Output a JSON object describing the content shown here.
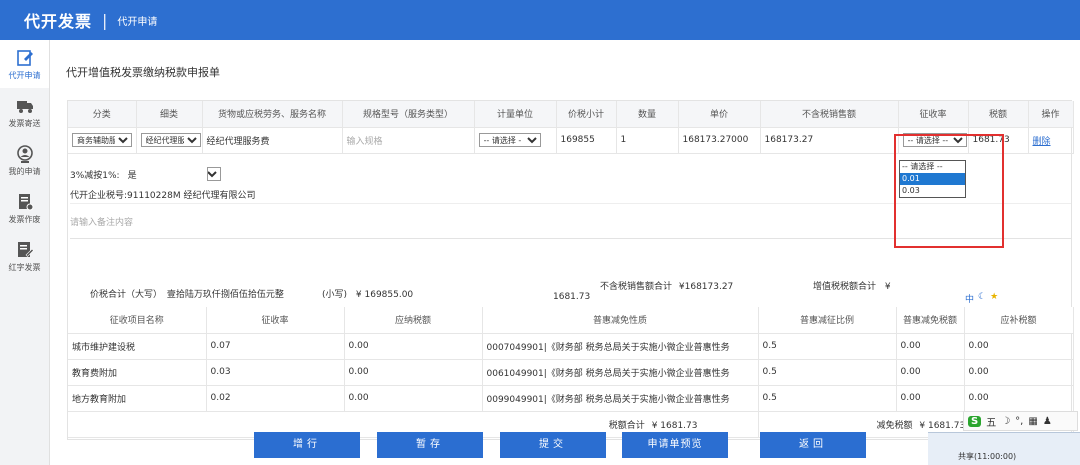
{
  "header": {
    "brand": "代开发票",
    "separator": "|",
    "subtitle": "代开申请"
  },
  "sidebar": {
    "items": [
      {
        "label": "代开申请",
        "icon": "edit-icon",
        "active": true
      },
      {
        "label": "发票寄送",
        "icon": "truck-icon",
        "active": false
      },
      {
        "label": "我的申请",
        "icon": "user-icon",
        "active": false
      },
      {
        "label": "发票作废",
        "icon": "document-icon",
        "active": false
      },
      {
        "label": "红字发票",
        "icon": "invoice-edit-icon",
        "active": false
      }
    ]
  },
  "page": {
    "title": "代开增值税发票缴纳税款申报单"
  },
  "goods_table": {
    "headers": [
      "分类",
      "细类",
      "货物或应税劳务、服务名称",
      "规格型号（服务类型）",
      "计量单位",
      "价税小计",
      "数量",
      "单价",
      "不含税销售额",
      "征收率",
      "税额",
      "操作"
    ],
    "row": {
      "category": "商务辅助服",
      "subcategory": "经纪代理服",
      "name": "经纪代理服务费",
      "spec_placeholder": "输入规格",
      "unit": "-- 请选择 -",
      "total": "169855",
      "quantity": "1",
      "unit_price": "168173.27000",
      "amount": "168173.27",
      "rate_selected": "-- 请选择 --",
      "tax": "1681.73",
      "delete_label": "删除"
    }
  },
  "rate_dropdown": {
    "options": [
      "-- 请选择 --",
      "0.01",
      "0.03"
    ],
    "highlighted": "0.01"
  },
  "reduce": {
    "label": "3%减按1%:",
    "value": "是"
  },
  "company": {
    "text": "代开企业税号:9111022​8M                      经纪代理有限公司"
  },
  "remark": {
    "placeholder": "请输入备注内容"
  },
  "totals": {
    "total_upper_label": "价税合计（大写）",
    "total_upper_value": "壹拾陆万玖仟捌佰伍拾伍元整",
    "total_lower_label": "(小写)",
    "total_lower_value": "¥ 169855.00",
    "excl_label": "不含税销售额合计",
    "excl_value": "¥168173.27",
    "excl_value_wrap": "1681.73",
    "vat_label": "增值税税额合计",
    "vat_value": "¥"
  },
  "levy_table": {
    "headers": [
      "征收项目名称",
      "征收率",
      "应纳税额",
      "普惠减免性质",
      "普惠减征比例",
      "普惠减免税额",
      "应补税额"
    ],
    "rows": [
      [
        "城市维护建设税",
        "0.07",
        "0.00",
        "0007049901|《财务部 税务总局关于实施小微企业普惠性务",
        "0.5",
        "0.00",
        "0.00"
      ],
      [
        "教育费附加",
        "0.03",
        "0.00",
        "0061049901|《财务部 税务总局关于实施小微企业普惠性务",
        "0.5",
        "0.00",
        "0.00"
      ],
      [
        "地方教育附加",
        "0.02",
        "0.00",
        "0099049901|《财务部 税务总局关于实施小微企业普惠性务",
        "0.5",
        "0.00",
        "0.00"
      ]
    ],
    "tax_sum_label": "税额合计",
    "tax_sum_value": "¥ 1681.73",
    "reduce_sum_label": "减免税额",
    "reduce_sum_value": "¥ 1681.73"
  },
  "buttons": {
    "add": "增行",
    "save": "暂存",
    "submit": "提交",
    "preview": "申请单预览",
    "back": "返回"
  },
  "ime": {
    "logo": "S",
    "mode": "五"
  },
  "taskbar": {
    "item": "共享(11:00:00)"
  },
  "colors": {
    "primary": "#2d6fd0",
    "highlight": "#e2302f",
    "selected": "#1f78d1"
  }
}
